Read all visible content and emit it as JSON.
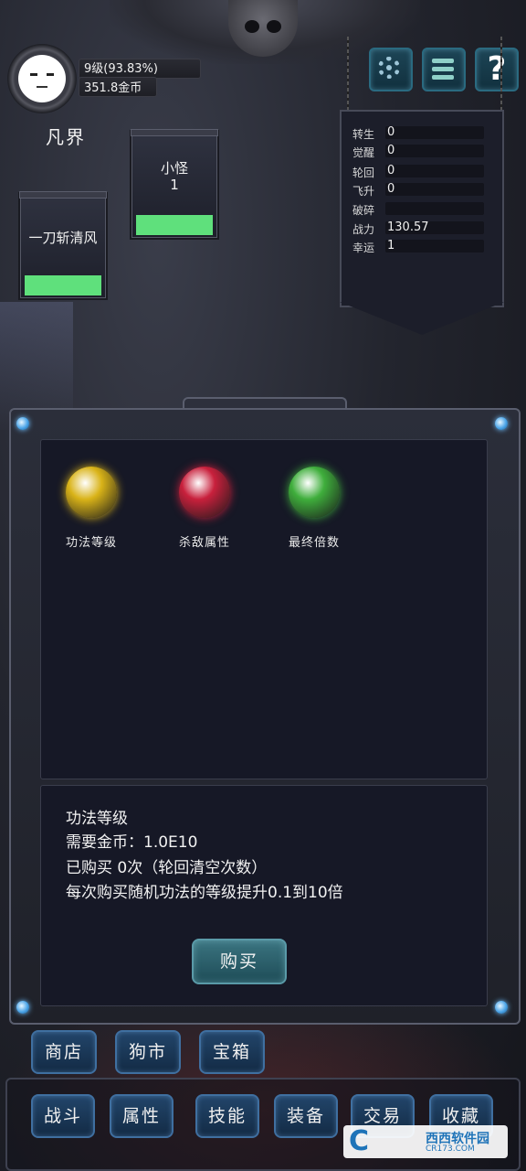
{
  "player": {
    "level_text": "9级(93.83%)",
    "gold_text": "351.8金币",
    "realm": "凡界"
  },
  "tiles": [
    {
      "name": "一刀斩清风",
      "hp": 1.0
    },
    {
      "name": "小怪",
      "count": "1",
      "hp": 1.0
    }
  ],
  "top_buttons": {
    "settings_icon": "gear-icon",
    "menu_icon": "menu-icon",
    "help_label": "?"
  },
  "stats": {
    "rows": [
      {
        "label": "转生",
        "value": "0"
      },
      {
        "label": "觉醒",
        "value": "0"
      },
      {
        "label": "轮回",
        "value": "0"
      },
      {
        "label": "飞升",
        "value": "0"
      },
      {
        "label": "破碎",
        "value": ""
      },
      {
        "label": "战力",
        "value": "130.57"
      },
      {
        "label": "幸运",
        "value": "1"
      }
    ]
  },
  "shop": {
    "orbs": [
      {
        "label": "功法等级",
        "color": "#d9b318"
      },
      {
        "label": "杀敌属性",
        "color": "#c8203c"
      },
      {
        "label": "最终倍数",
        "color": "#3fae3c"
      }
    ],
    "detail": {
      "title": "功法等级",
      "cost": "需要金币：1.0E10",
      "bought": "已购买 0次（轮回清空次数）",
      "effect": "每次购买随机功法的等级提升0.1到10倍"
    },
    "buy_label": "购买"
  },
  "subnav": [
    "商店",
    "狗市",
    "宝箱"
  ],
  "mainnav": [
    "战斗",
    "属性",
    "技能",
    "装备",
    "交易",
    "收藏"
  ],
  "watermark": {
    "brand": "西西软件园",
    "url": "CR173.COM",
    "letter": "C"
  }
}
